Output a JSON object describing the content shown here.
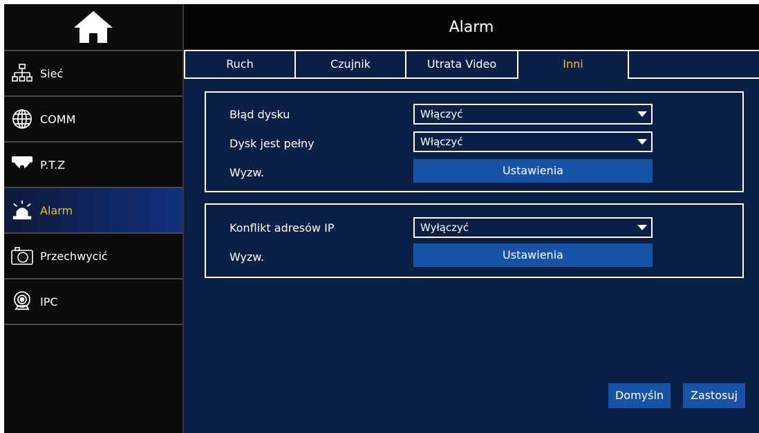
{
  "window": {
    "title": "Alarm"
  },
  "sidebar": {
    "home_icon": "home-icon",
    "items": [
      {
        "label": "Sieć",
        "icon": "network-icon"
      },
      {
        "label": "COMM",
        "icon": "globe-icon"
      },
      {
        "label": "P.T.Z",
        "icon": "dome-camera-icon"
      },
      {
        "label": "Alarm",
        "icon": "alarm-siren-icon",
        "active": true
      },
      {
        "label": "Przechwycić",
        "icon": "camera-icon"
      },
      {
        "label": "IPC",
        "icon": "webcam-icon"
      }
    ]
  },
  "tabs": [
    {
      "label": "Ruch"
    },
    {
      "label": "Czujnik"
    },
    {
      "label": "Utrata Video"
    },
    {
      "label": "Inni",
      "active": true
    }
  ],
  "group1": {
    "disk_error_label": "Błąd dysku",
    "disk_error_value": "Włączyć",
    "disk_full_label": "Dysk jest pełny",
    "disk_full_value": "Włączyć",
    "trigger_label": "Wyzw.",
    "settings_button": "Ustawienia"
  },
  "group2": {
    "ip_conflict_label": "Konflikt adresów IP",
    "ip_conflict_value": "Wyłączyć",
    "trigger_label": "Wyzw.",
    "settings_button": "Ustawienia"
  },
  "footer": {
    "default_button": "Domyśln",
    "apply_button": "Zastosuj"
  },
  "colors": {
    "accent": "#f5c400",
    "panel_bg": "#0a2046",
    "button_bg": "#1753a6",
    "sidebar_bg": "#0b0b0b"
  }
}
